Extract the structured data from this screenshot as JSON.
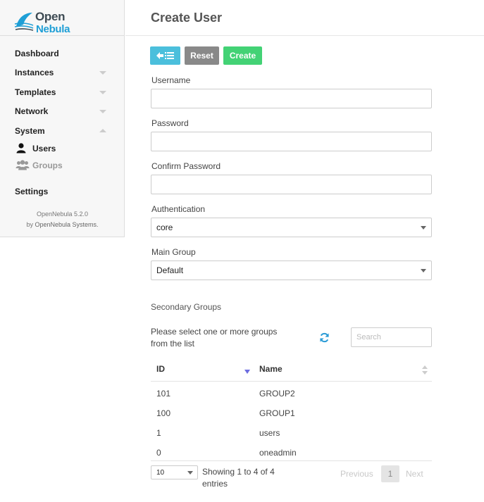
{
  "brand": {
    "name_top": "Open",
    "name_bottom": "Nebula"
  },
  "sidebar": {
    "items": [
      {
        "label": "Dashboard"
      },
      {
        "label": "Instances"
      },
      {
        "label": "Templates"
      },
      {
        "label": "Network"
      },
      {
        "label": "System"
      }
    ],
    "sub_items": [
      {
        "label": "Users",
        "icon": "user-icon",
        "active": true
      },
      {
        "label": "Groups",
        "icon": "users-icon",
        "active": false
      }
    ],
    "settings_label": "Settings",
    "version": "OpenNebula 5.2.0",
    "vendor_prefix": "by",
    "vendor": "OpenNebula Systems."
  },
  "page": {
    "title": "Create User"
  },
  "toolbar": {
    "back_icon": "back-to-list-icon",
    "reset_label": "Reset",
    "create_label": "Create"
  },
  "form": {
    "username_label": "Username",
    "username_value": "",
    "password_label": "Password",
    "password_value": "",
    "confirm_password_label": "Confirm Password",
    "confirm_password_value": "",
    "authentication_label": "Authentication",
    "authentication_value": "core",
    "main_group_label": "Main Group",
    "main_group_value": "Default",
    "secondary_groups_label": "Secondary Groups",
    "select_hint": "Please select one or more groups from the list",
    "search_placeholder": "Search"
  },
  "table": {
    "columns": [
      "ID",
      "Name"
    ],
    "rows": [
      {
        "id": "101",
        "name": "GROUP2"
      },
      {
        "id": "100",
        "name": "GROUP1"
      },
      {
        "id": "1",
        "name": "users"
      },
      {
        "id": "0",
        "name": "oneadmin"
      }
    ],
    "page_length": "10",
    "info": "Showing 1 to 4 of 4 entries",
    "previous_label": "Previous",
    "current_page": "1",
    "next_label": "Next"
  },
  "colors": {
    "back_button": "#4bbfdc",
    "reset_button": "#898989",
    "create_button": "#43d275",
    "brand_blue": "#1f9fd6",
    "sort_arrow": "#6c6ce0"
  }
}
